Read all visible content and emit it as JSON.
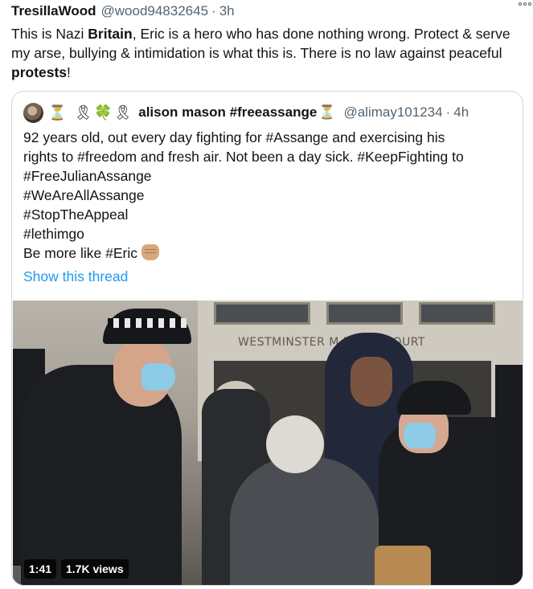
{
  "tweet": {
    "display_name": "TresillaWood",
    "handle": "@wood94832645",
    "separator": "·",
    "time": "3h",
    "text": {
      "p1": "This is Nazi ",
      "b1": "Britain",
      "p2": ", Eric is a hero who has done nothing wrong. Protect & serve my arse, bullying & intimidation is what this is. There is no law against peaceful ",
      "b2": "protests",
      "p3": "!"
    },
    "more_icon": "more-options-icon"
  },
  "quoted": {
    "avatar": "avatar",
    "name_emoji": "⏳ 🎗🍀🎗",
    "name": "alison mason #freeassange",
    "name_suffix": "⏳",
    "handle": "@alimay101234",
    "separator": "·",
    "time": "4h",
    "lines": [
      "92 years old, out every day fighting for #Assange  and exercising his",
      "rights to #freedom and fresh air. Not been a day sick. #KeepFighting to",
      "#FreeJulianAssange",
      "#WeAreAllAssange",
      "#StopTheAppeal",
      "#lethimgo",
      "Be more like #Eric "
    ],
    "fist_icon": "raised-fist-icon",
    "show_thread": "Show this thread",
    "video": {
      "sign": "WESTMINSTER M    RATES COURT",
      "duration": "1:41",
      "views": "1.7K views"
    }
  }
}
